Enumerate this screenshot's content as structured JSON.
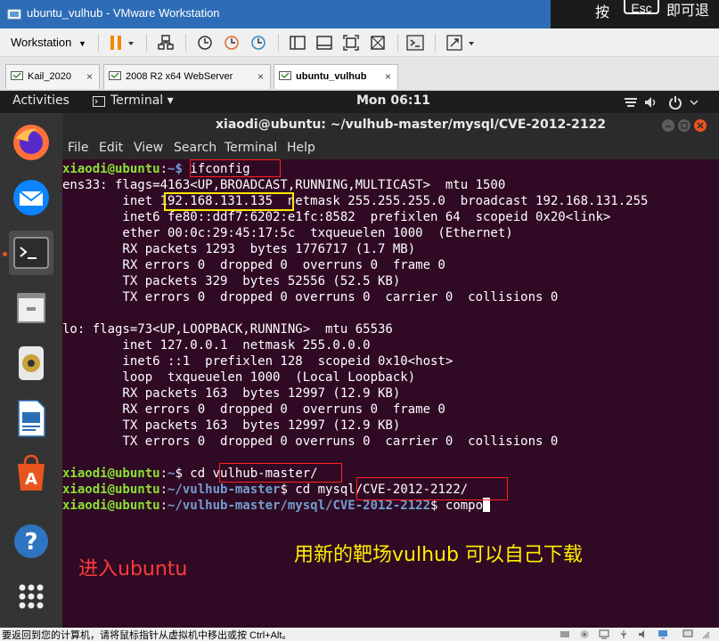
{
  "window": {
    "title": "ubuntu_vulhub - VMware Workstation",
    "overlay_left": "按",
    "overlay_key": "Esc",
    "overlay_right": "即可退"
  },
  "toolbar": {
    "workstation_label": "Workstation",
    "workstation_arrow": "▼"
  },
  "tabs": [
    {
      "label": "Kail_2020",
      "close": "×"
    },
    {
      "label": "2008 R2 x64 WebServer",
      "close": "×"
    },
    {
      "label": "ubuntu_vulhub",
      "close": "×"
    }
  ],
  "gnome": {
    "activities": "Activities",
    "terminal_menu": "Terminal ▾",
    "clock": "Mon 06:11"
  },
  "terminal": {
    "window_title": "xiaodi@ubuntu: ~/vulhub-master/mysql/CVE-2012-2122",
    "menu": [
      "File",
      "Edit",
      "View",
      "Search",
      "Terminal",
      "Help"
    ],
    "prompt_user": "xiaodi@ubuntu",
    "lines": {
      "l1_cmd": " ifconfig",
      "l2": "ens33: flags=4163<UP,BROADCAST,RUNNING,MULTICAST>  mtu 1500",
      "l3": "        inet 192.168.131.135  netmask 255.255.255.0  broadcast 192.168.131.255",
      "l4": "        inet6 fe80::ddf7:6202:e1fc:8582  prefixlen 64  scopeid 0x20<link>",
      "l5": "        ether 00:0c:29:45:17:5c  txqueuelen 1000  (Ethernet)",
      "l6": "        RX packets 1293  bytes 1776717 (1.7 MB)",
      "l7": "        RX errors 0  dropped 0  overruns 0  frame 0",
      "l8": "        TX packets 329  bytes 52556 (52.5 KB)",
      "l9": "        TX errors 0  dropped 0 overruns 0  carrier 0  collisions 0",
      "l11": "lo: flags=73<UP,LOOPBACK,RUNNING>  mtu 65536",
      "l12": "        inet 127.0.0.1  netmask 255.0.0.0",
      "l13": "        inet6 ::1  prefixlen 128  scopeid 0x10<host>",
      "l14": "        loop  txqueuelen 1000  (Local Loopback)",
      "l15": "        RX packets 163  bytes 12997 (12.9 KB)",
      "l16": "        RX errors 0  dropped 0  overruns 0  frame 0",
      "l17": "        TX packets 163  bytes 12997 (12.9 KB)",
      "l18": "        TX errors 0  dropped 0 overruns 0  carrier 0  collisions 0",
      "l20_path": "~",
      "l20_cmd": "$ cd vulhub-master/",
      "l21_path": "~/vulhub-master",
      "l21_cmd": "$ cd mysql/CVE-2012-2122/",
      "l22_path": "~/vulhub-master/mysql/CVE-2012-2122",
      "l22_cmd": "$ compo"
    },
    "colon": ":",
    "prompt_tilde_dollar": "~$"
  },
  "annotations": {
    "enter_ubuntu": "进入ubuntu",
    "new_range": "用新的靶场vulhub 可以自己下载"
  },
  "status_bar": {
    "text": "要返回到您的计算机，请将鼠标指针从虚拟机中移出或按 Ctrl+Alt。"
  },
  "colors": {
    "terminal_bg": "#300a24",
    "prompt_user": "#8ae234",
    "prompt_path": "#729fcf",
    "highlight_red": "#ff2020",
    "highlight_yellow": "#ffe600",
    "vmware_title": "#2d6cb7"
  }
}
